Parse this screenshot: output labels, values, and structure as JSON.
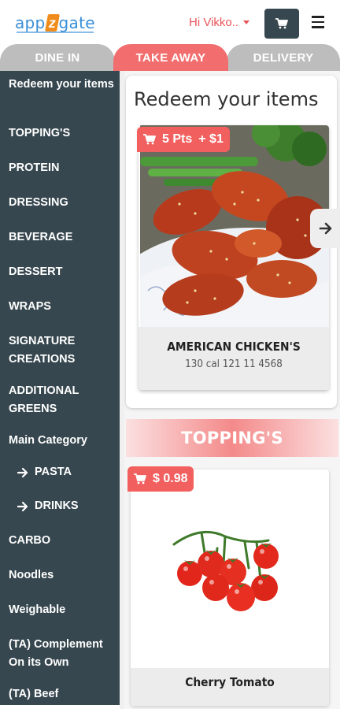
{
  "header": {
    "logo_left": "app",
    "logo_z": "z",
    "logo_right": "gate",
    "greeting": "Hi Vikko..",
    "cart_icon": "cart-icon",
    "menu_icon": "hamburger-menu-icon"
  },
  "tabs": [
    {
      "label": "DINE IN",
      "active": false
    },
    {
      "label": "TAKE AWAY",
      "active": true
    },
    {
      "label": "DELIVERY",
      "active": false
    }
  ],
  "sidebar": {
    "items": [
      {
        "label": "Redeem your items"
      },
      {
        "label": "TOPPING'S"
      },
      {
        "label": "PROTEIN"
      },
      {
        "label": "DRESSING"
      },
      {
        "label": "BEVERAGE"
      },
      {
        "label": "DESSERT"
      },
      {
        "label": "WRAPS"
      },
      {
        "label": "SIGNATURE CREATIONS"
      },
      {
        "label": "ADDITIONAL GREENS"
      },
      {
        "label": "Main Category"
      },
      {
        "label": "PASTA"
      },
      {
        "label": "DRINKS"
      },
      {
        "label": "CARBO"
      },
      {
        "label": "Noodles"
      },
      {
        "label": "Weighable"
      },
      {
        "label": "(TA) Complement On its Own"
      },
      {
        "label": "(TA) Beef"
      }
    ]
  },
  "redeem": {
    "title": "Redeem your items",
    "badge_points": "5 Pts",
    "badge_price": "+ $1",
    "product_name": "AMERICAN CHICKEN'S",
    "product_sub": "130 cal 121 11 4568"
  },
  "toppings": {
    "title": "TOPPING'S",
    "price": "$ 0.98",
    "product_name": "Cherry Tomato"
  },
  "colors": {
    "accent": "#f26d6d",
    "sidebar_bg": "#37474f",
    "tab_inactive": "#bdbdbd",
    "brand_blue": "#3a8fd6"
  }
}
